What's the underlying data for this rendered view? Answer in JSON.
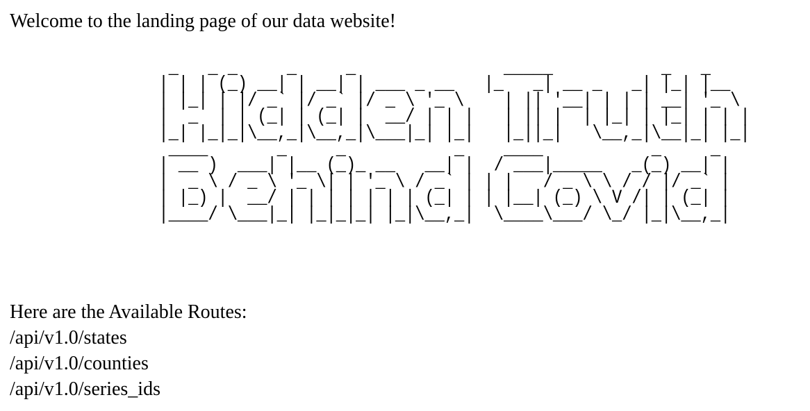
{
  "welcome_text": "Welcome to the landing page of our data website!",
  "ascii_banner": "   _   _ _     _     _               _____           _   _     \n  | | | (_) __| | __| | ___ _ __   |_   _| __ _   _| |_| |__  \n  | |_| | |/ _` |/ _` |/ _ \\ '_ \\    | || '__| | | | __| '_ \\ \n  |  _  | | (_| | (_| |  __/ | | |   | || |  | |_| | |_| | | |\n  |_| |_|_|\\__,_|\\__,_|\\___|_| |_|   |_||_|   \\__,_|\\__|_| |_|\n   ____       _     _           _    ____           _     _ \n  | __ )  ___| |__ (_)_ __   __| |  / ___|_____   _(_) __| |\n  |  _ \\ / _ \\ '_ \\| | '_ \\ / _` | | |   / _ \\ \\ / / |/ _` |\n  | |_) |  __/ | | | | | | | (_| | | |__| (_) \\ V /| | (_| |\n  |____/ \\___|_| |_|_|_| |_|\\__,_|  \\____\\___/ \\_/ |_|\\__,_|",
  "routes": {
    "heading": "Here are the Available Routes:",
    "items": [
      "/api/v1.0/states",
      "/api/v1.0/counties",
      "/api/v1.0/series_ids"
    ]
  }
}
